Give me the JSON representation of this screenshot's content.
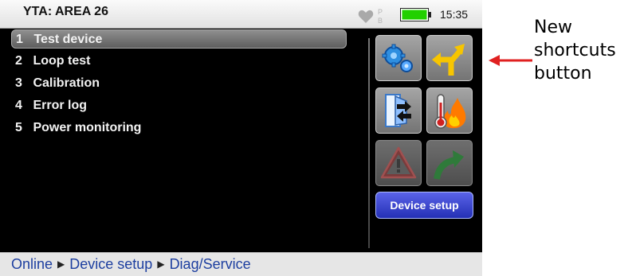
{
  "header": {
    "title": "YTA: AREA 26",
    "bluetooth_label": "B",
    "time": "15:35",
    "battery_color": "#22d000"
  },
  "menu": {
    "items": [
      {
        "num": "1",
        "label": "Test device",
        "selected": true
      },
      {
        "num": "2",
        "label": "Loop test",
        "selected": false
      },
      {
        "num": "3",
        "label": "Calibration",
        "selected": false
      },
      {
        "num": "4",
        "label": "Error log",
        "selected": false
      },
      {
        "num": "5",
        "label": "Power monitoring",
        "selected": false
      }
    ]
  },
  "shortcuts": {
    "buttons": [
      {
        "icon": "gears-icon"
      },
      {
        "icon": "shortcut-arrows-icon"
      },
      {
        "icon": "device-transfer-icon"
      },
      {
        "icon": "temperature-fire-icon"
      },
      {
        "icon": "warning-icon"
      },
      {
        "icon": "green-arrow-icon"
      }
    ],
    "device_setup_label": "Device setup"
  },
  "breadcrumb": {
    "items": [
      "Online",
      "Device setup",
      "Diag/Service"
    ]
  },
  "annotation": {
    "line1": "New",
    "line2": "shortcuts",
    "line3": "button",
    "arrow_color": "#e02020"
  }
}
